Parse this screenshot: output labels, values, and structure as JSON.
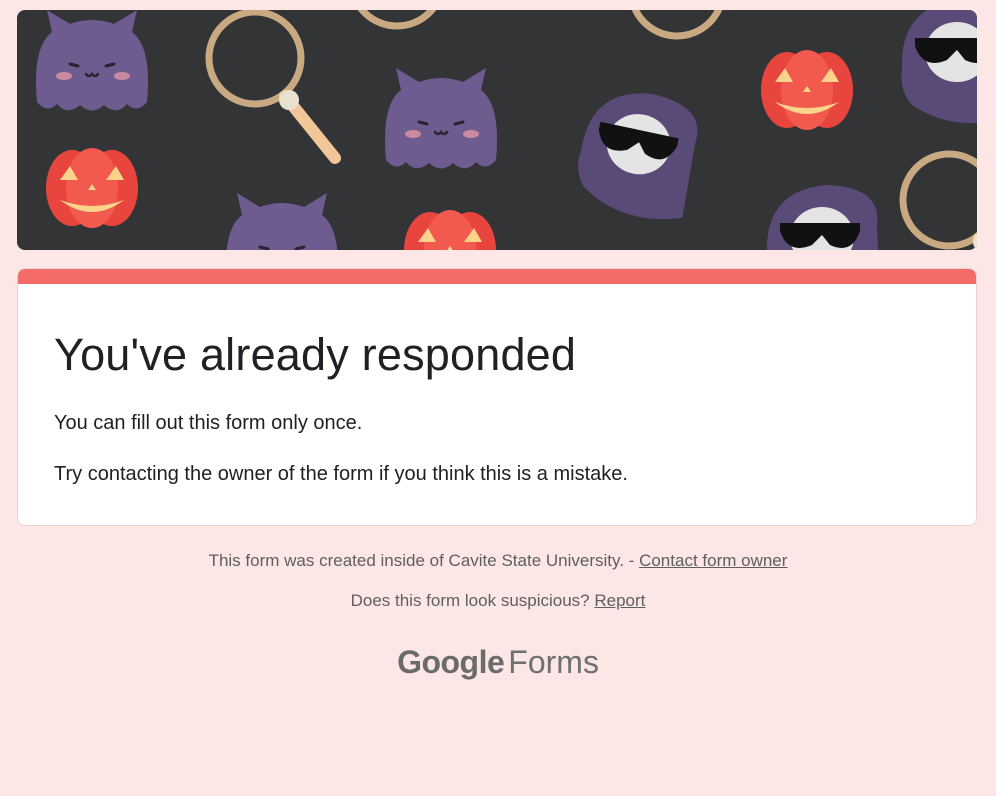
{
  "banner": {
    "colors": {
      "background": "#323436",
      "ghost": "#6e5b8f",
      "reaper_hood": "#5a4a78",
      "pumpkin": "#f0524a",
      "pumpkin_face": "#fbd38a",
      "magnifier_ring": "#c8a982",
      "magnifier_handle": "#f1c799",
      "skull": "#e6e6e6",
      "sunglasses": "#111111"
    },
    "icons": [
      "ghost-icon",
      "pumpkin-icon",
      "magnifier-icon",
      "reaper-icon"
    ]
  },
  "card": {
    "accent_color": "#f46b68",
    "title": "You've already responded",
    "line1": "You can fill out this form only once.",
    "line2": "Try contacting the owner of the form if you think this is a mistake."
  },
  "footer": {
    "created_text": "This form was created inside of Cavite State University. - ",
    "contact_link": "Contact form owner",
    "suspicious_text": "Does this form look suspicious? ",
    "report_link": "Report"
  },
  "brand": {
    "google": "Google",
    "forms": "Forms"
  }
}
